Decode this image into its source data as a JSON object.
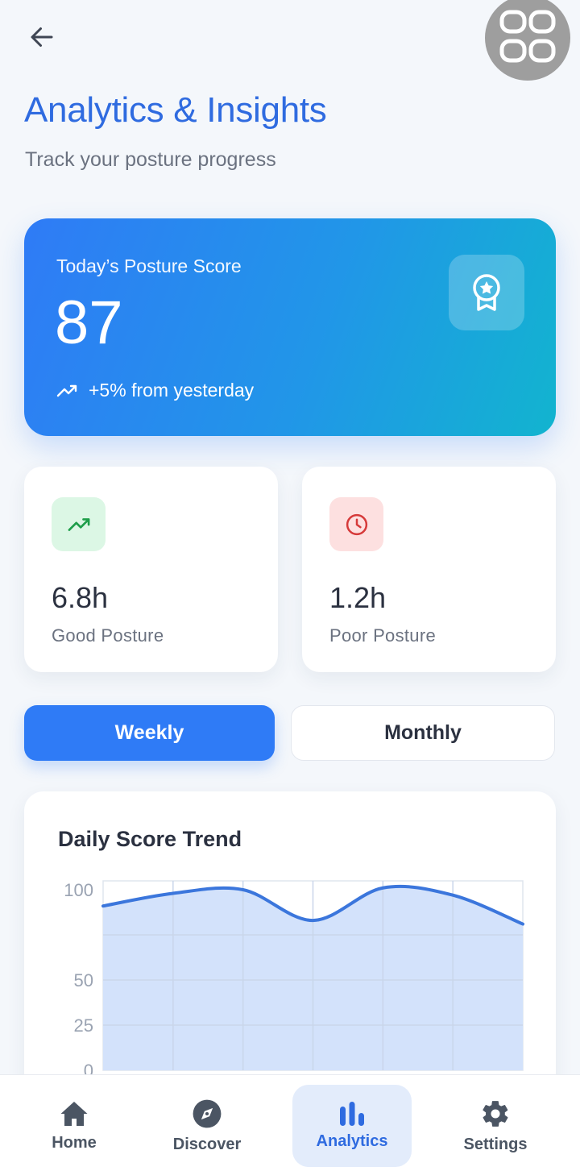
{
  "header": {
    "title": "Analytics & Insights",
    "subtitle": "Track your posture progress"
  },
  "score_card": {
    "label": "Today’s Posture Score",
    "value": "87",
    "change": "+5% from yesterday",
    "badge_icon": "award-icon",
    "change_icon": "trending-up-icon"
  },
  "stats": [
    {
      "value": "6.8h",
      "label": "Good Posture",
      "icon": "trending-up-icon",
      "accent": "#1e9e4a",
      "accent_bg": "#dcf7e5"
    },
    {
      "value": "1.2h",
      "label": "Poor Posture",
      "icon": "clock-icon",
      "accent": "#d63a3a",
      "accent_bg": "#fde0e0"
    }
  ],
  "tabs": {
    "weekly": "Weekly",
    "monthly": "Monthly",
    "selected": "Weekly"
  },
  "chart": {
    "title": "Daily Score Trend"
  },
  "chart_data": {
    "type": "area",
    "title": "Daily Score Trend",
    "xlabel": "",
    "ylabel": "",
    "x": [
      0,
      1,
      2,
      3,
      4,
      5,
      6
    ],
    "series": [
      {
        "values": [
          91,
          98,
          100,
          83,
          101,
          97,
          81
        ]
      }
    ],
    "yticks": [
      0,
      25,
      50,
      100
    ],
    "ylim": [
      0,
      100
    ],
    "grid": true,
    "line_color": "#3b76dc",
    "fill_color": "#d3e2fb"
  },
  "nav": {
    "items": [
      {
        "label": "Home",
        "icon": "home-icon"
      },
      {
        "label": "Discover",
        "icon": "compass-icon"
      },
      {
        "label": "Analytics",
        "icon": "bar-chart-icon"
      },
      {
        "label": "Settings",
        "icon": "gear-icon"
      }
    ],
    "active": "Analytics"
  },
  "colors": {
    "primary": "#2f7bf6",
    "title_blue": "#2f6be0",
    "background": "#f4f7fb"
  }
}
